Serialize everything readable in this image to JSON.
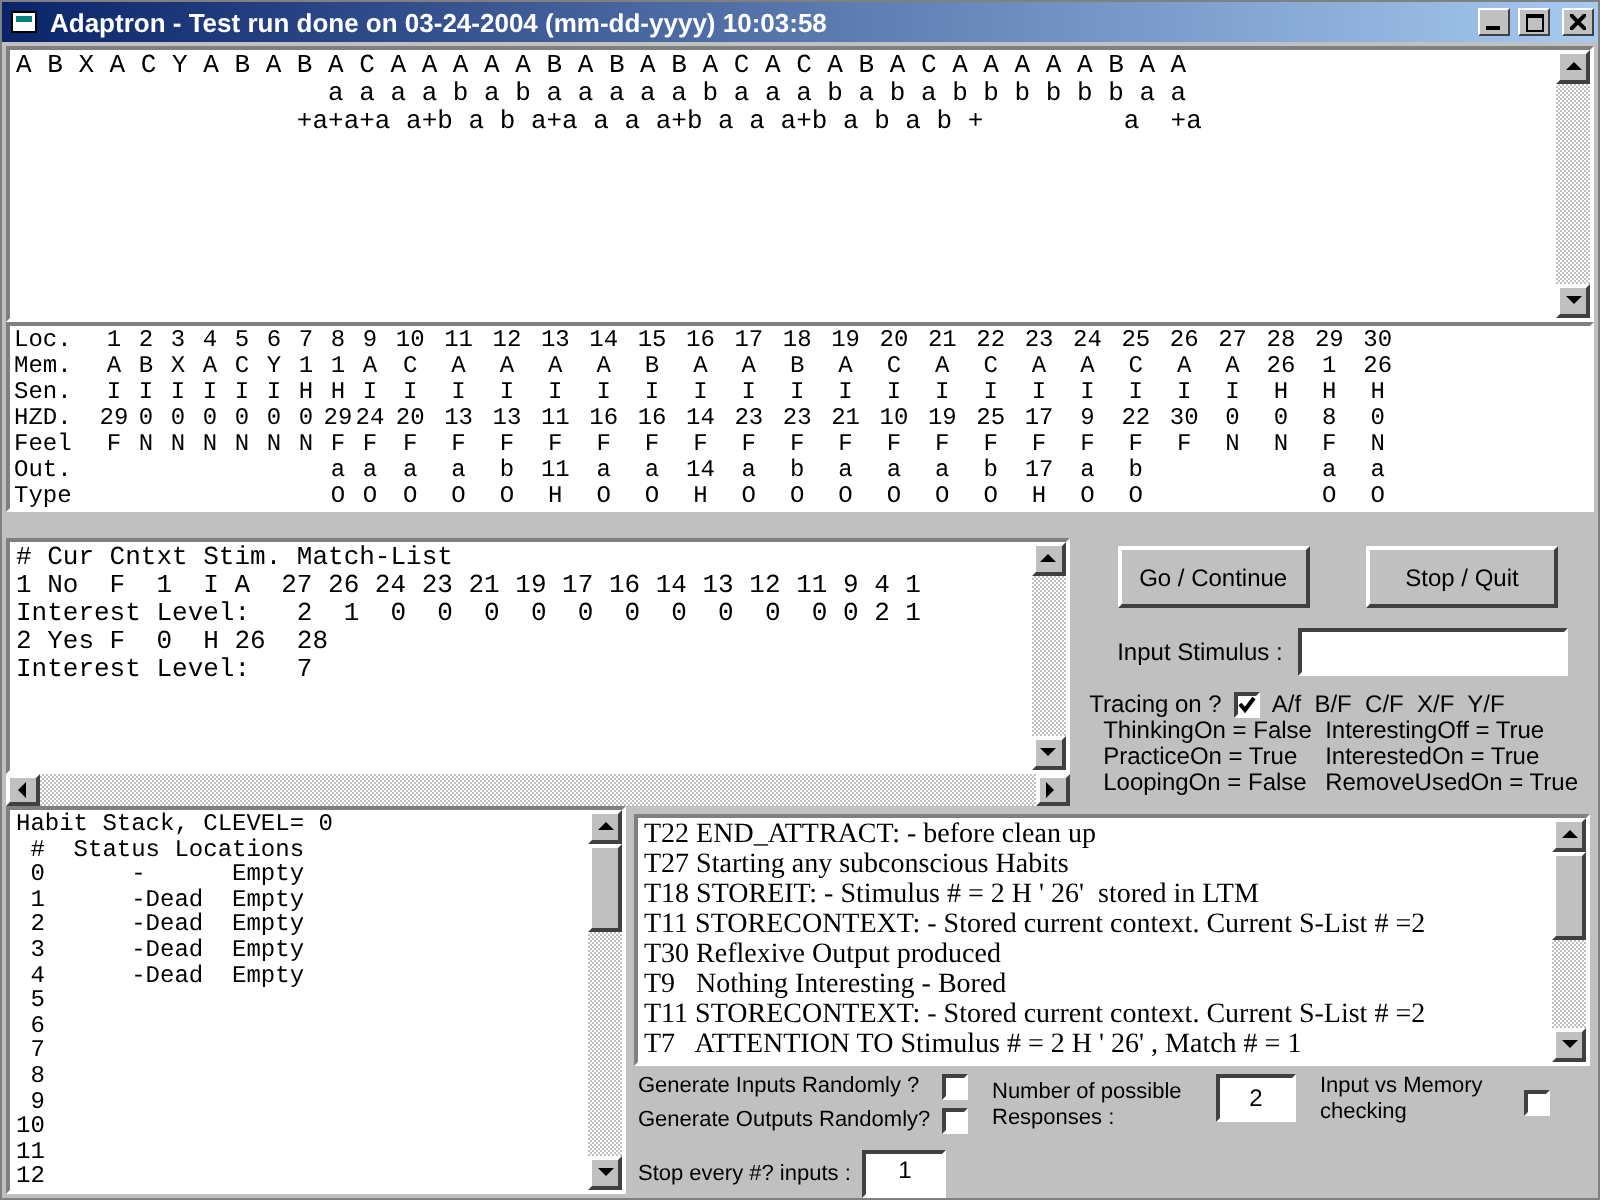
{
  "window": {
    "title": "Adaptron - Test run done on 03-24-2004 (mm-dd-yyyy) 10:03:58"
  },
  "sequence_lines": [
    "A B X A C Y A B A B A C A A A A A B A B A B A C A C A B A C A A A A A B A A",
    "                    a a a a b a b a a a a a b a a a b a b a b b b b b b a a",
    "                  +a+a+a a+b a b a+a a a a+b a a a+b a b a b +         a  +a"
  ],
  "memory_table": {
    "row_labels": [
      "Loc.",
      "Mem.",
      "Sen.",
      "HZD.",
      "Feel",
      "Out.",
      "Type"
    ],
    "locations": [
      {
        "loc": "1",
        "mem": "A",
        "sen": "I",
        "hzd": "29",
        "feel": "F"
      },
      {
        "loc": "2",
        "mem": "B",
        "sen": "I",
        "hzd": "0",
        "feel": "N"
      },
      {
        "loc": "3",
        "mem": "X",
        "sen": "I",
        "hzd": "0",
        "feel": "N"
      },
      {
        "loc": "4",
        "mem": "A",
        "sen": "I",
        "hzd": "0",
        "feel": "N"
      },
      {
        "loc": "5",
        "mem": "C",
        "sen": "I",
        "hzd": "0",
        "feel": "N"
      },
      {
        "loc": "6",
        "mem": "Y",
        "sen": "I",
        "hzd": "0",
        "feel": "N"
      },
      {
        "loc": "7",
        "mem": "1",
        "sen": "H",
        "hzd": "0",
        "feel": "N"
      },
      {
        "loc": "8",
        "mem": "1",
        "sen": "H",
        "hzd": "29",
        "feel": "F",
        "out": "a",
        "type": "O"
      },
      {
        "loc": "9",
        "mem": "A",
        "sen": "I",
        "hzd": "24",
        "feel": "F",
        "out": "a",
        "type": "O"
      },
      {
        "loc": "10",
        "mem": "C",
        "sen": "I",
        "hzd": "20",
        "feel": "F",
        "out": "a",
        "type": "O"
      },
      {
        "loc": "11",
        "mem": "A",
        "sen": "I",
        "hzd": "13",
        "feel": "F",
        "out": "a",
        "type": "O"
      },
      {
        "loc": "12",
        "mem": "A",
        "sen": "I",
        "hzd": "13",
        "feel": "F",
        "out": "b",
        "type": "O"
      },
      {
        "loc": "13",
        "mem": "A",
        "sen": "I",
        "hzd": "11",
        "feel": "F",
        "out": "11",
        "type": "H"
      },
      {
        "loc": "14",
        "mem": "A",
        "sen": "I",
        "hzd": "16",
        "feel": "F",
        "out": "a",
        "type": "O"
      },
      {
        "loc": "15",
        "mem": "B",
        "sen": "I",
        "hzd": "16",
        "feel": "F",
        "out": "a",
        "type": "O"
      },
      {
        "loc": "16",
        "mem": "A",
        "sen": "I",
        "hzd": "14",
        "feel": "F",
        "out": "14",
        "type": "H"
      },
      {
        "loc": "17",
        "mem": "A",
        "sen": "I",
        "hzd": "23",
        "feel": "F",
        "out": "a",
        "type": "O"
      },
      {
        "loc": "18",
        "mem": "B",
        "sen": "I",
        "hzd": "23",
        "feel": "F",
        "out": "b",
        "type": "O"
      },
      {
        "loc": "19",
        "mem": "A",
        "sen": "I",
        "hzd": "21",
        "feel": "F",
        "out": "a",
        "type": "O"
      },
      {
        "loc": "20",
        "mem": "C",
        "sen": "I",
        "hzd": "10",
        "feel": "F",
        "out": "a",
        "type": "O"
      },
      {
        "loc": "21",
        "mem": "A",
        "sen": "I",
        "hzd": "19",
        "feel": "F",
        "out": "a",
        "type": "O"
      },
      {
        "loc": "22",
        "mem": "C",
        "sen": "I",
        "hzd": "25",
        "feel": "F",
        "out": "b",
        "type": "O"
      },
      {
        "loc": "23",
        "mem": "A",
        "sen": "I",
        "hzd": "17",
        "feel": "F",
        "out": "17",
        "type": "H"
      },
      {
        "loc": "24",
        "mem": "A",
        "sen": "I",
        "hzd": "9",
        "feel": "F",
        "out": "a",
        "type": "O"
      },
      {
        "loc": "25",
        "mem": "C",
        "sen": "I",
        "hzd": "22",
        "feel": "F",
        "out": "b",
        "type": "O"
      },
      {
        "loc": "26",
        "mem": "A",
        "sen": "I",
        "hzd": "30",
        "feel": "F"
      },
      {
        "loc": "27",
        "mem": "A",
        "sen": "I",
        "hzd": "0",
        "feel": "N"
      },
      {
        "loc": "28",
        "mem": "26",
        "sen": "H",
        "hzd": "0",
        "feel": "N"
      },
      {
        "loc": "29",
        "mem": "1",
        "sen": "H",
        "hzd": "8",
        "feel": "F",
        "out": "a",
        "type": "O"
      },
      {
        "loc": "30",
        "mem": "26",
        "sen": "H",
        "hzd": "0",
        "feel": "N",
        "out": "a",
        "type": "O"
      }
    ]
  },
  "match_lines": [
    "# Cur Cntxt Stim. Match-List",
    "1 No  F  1  I A  27 26 24 23 21 19 17 16 14 13 12 11 9 4 1",
    "Interest Level:   2  1  0  0  0  0  0  0  0  0  0  0 0 2 1",
    "2 Yes F  0  H 26  28",
    "Interest Level:   7"
  ],
  "buttons": [
    "Go / Continue",
    "Stop / Quit"
  ],
  "input_stimulus": {
    "label": "Input Stimulus :"
  },
  "tracing": {
    "label": "Tracing on ?",
    "checked": true,
    "keys": "A/f  B/F  C/F  X/F  Y/F"
  },
  "flags": [
    "ThinkingOn = False",
    "InterestingOff = True",
    "PracticeOn = True",
    "InterestedOn = True",
    "LoopingOn = False",
    "RemoveUsedOn = True"
  ],
  "habit_lines": [
    "Habit Stack, CLEVEL= 0",
    " #  Status Locations",
    " 0      -      Empty",
    " 1      -Dead  Empty",
    " 2      -Dead  Empty",
    " 3      -Dead  Empty",
    " 4      -Dead  Empty",
    " 5",
    " 6",
    " 7",
    " 8",
    " 9",
    "10",
    "11",
    "12"
  ],
  "log_lines": [
    "T22 END_ATTRACT: - before clean up",
    "T27 Starting any subconscious Habits",
    "T18 STOREIT: - Stimulus # = 2 H ' 26'  stored in LTM",
    "T11 STORECONTEXT: - Stored current context. Current S-List # =2",
    "T30 Reflexive Output produced",
    "T9   Nothing Interesting - Bored",
    "T11 STORECONTEXT: - Stored current context. Current S-List # =2",
    "T7   ATTENTION TO Stimulus # = 2 H ' 26' , Match # = 1"
  ],
  "generate_inputs": {
    "label": "Generate Inputs Randomly ?",
    "checked": false
  },
  "generate_outputs": {
    "label": "Generate Outputs Randomly?",
    "checked": false
  },
  "responses": {
    "label": "Number of possible Responses :",
    "value": "2"
  },
  "memory_checking": {
    "label": "Input vs Memory checking",
    "checked": false
  },
  "stop_every": {
    "label": "Stop every #? inputs :",
    "value": "1"
  }
}
